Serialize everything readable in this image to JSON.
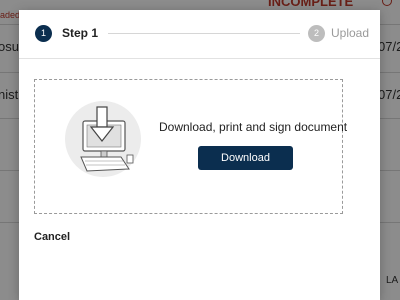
{
  "background": {
    "top_red_text": "INCOMPLETE",
    "loaded_text": "aded",
    "row1_left": "osu",
    "row1_right": "07/2",
    "row2_left": "nistr",
    "row2_right": "07/2",
    "bottom_right": "LA"
  },
  "modal": {
    "steps": [
      {
        "number": "1",
        "label": "Step 1",
        "state": "active"
      },
      {
        "number": "2",
        "label": "Upload",
        "state": "inactive"
      }
    ],
    "instruction": "Download, print and sign document",
    "download_label": "Download",
    "cancel_label": "Cancel"
  },
  "colors": {
    "primary": "#0b2e4f",
    "inactive_step": "#bdbdbd",
    "alert_red": "#c0392b"
  },
  "icons": {
    "illustration": "download-computer-illustration"
  }
}
